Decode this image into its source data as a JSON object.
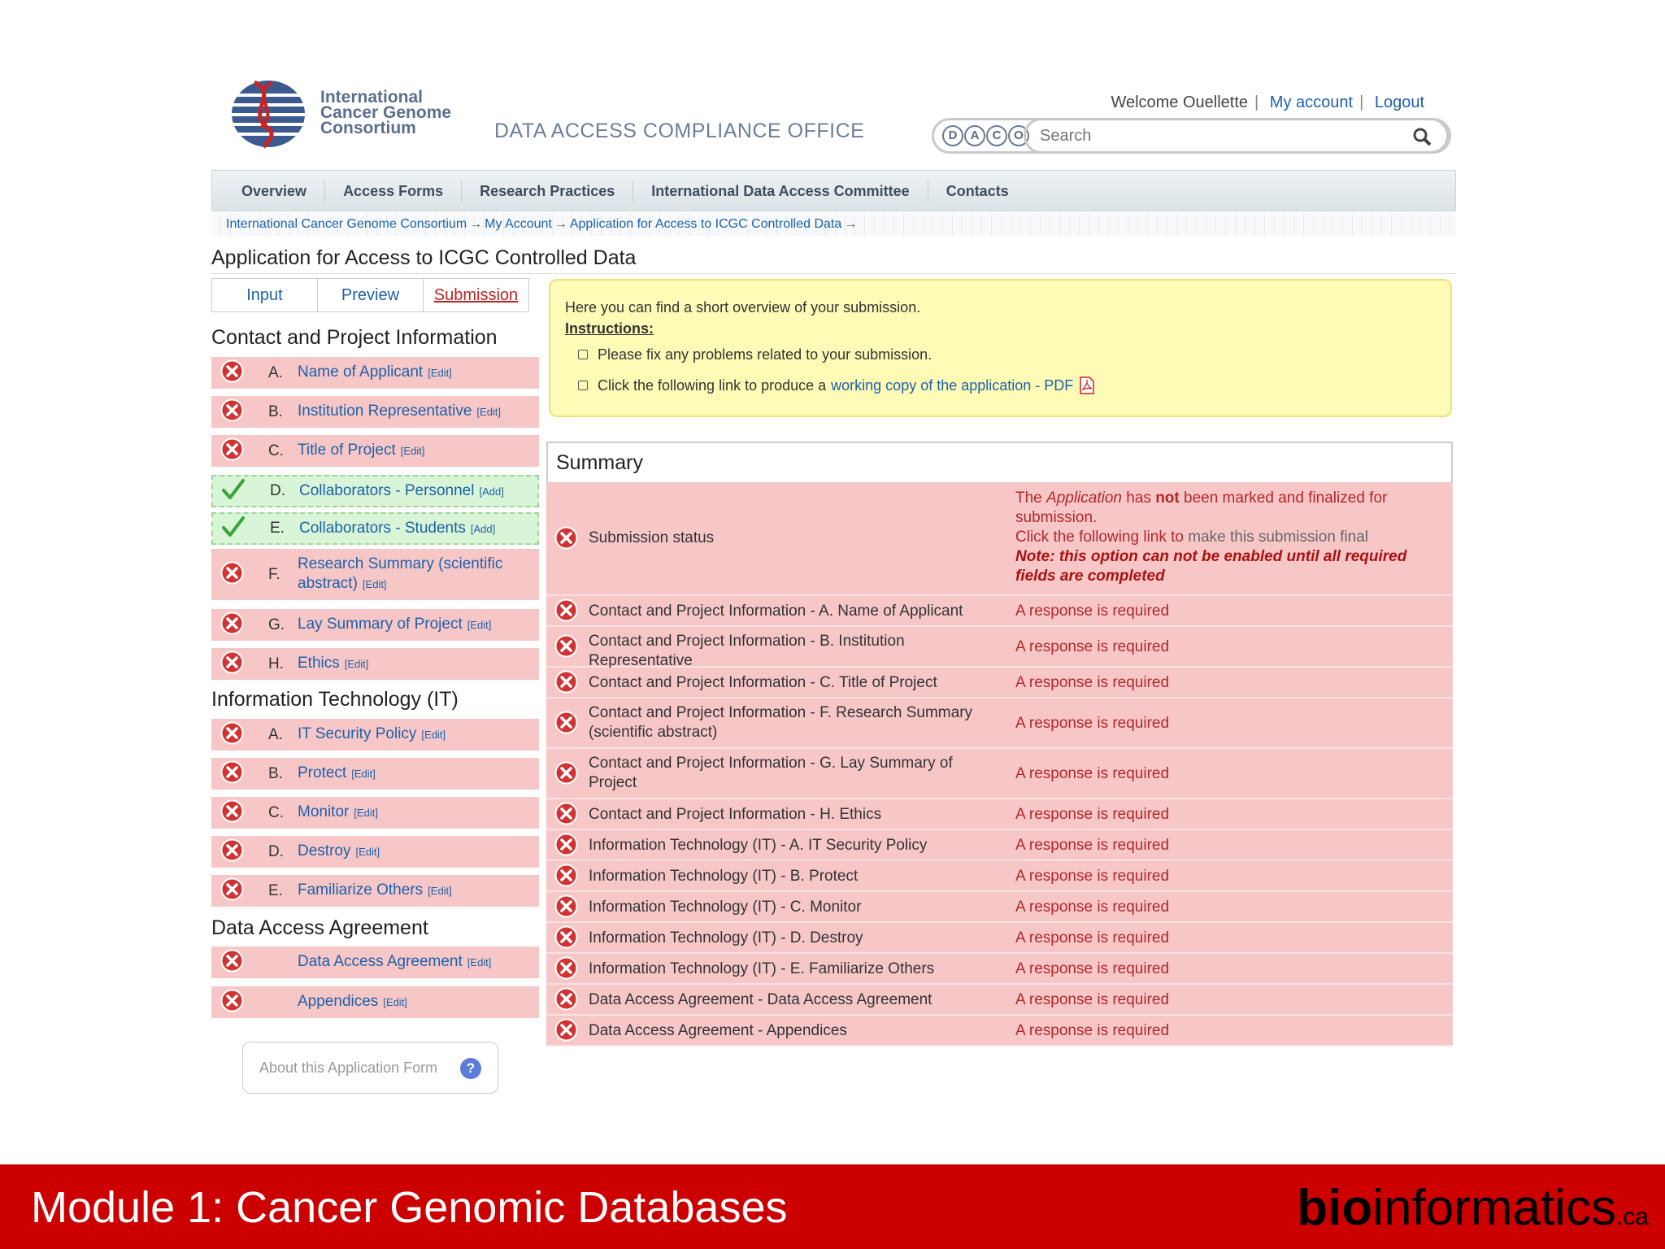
{
  "header": {
    "logo_text_1": "International",
    "logo_text_2": "Cancer Genome",
    "logo_text_3": "Consortium",
    "office": "DATA ACCESS COMPLIANCE OFFICE",
    "welcome": "Welcome Ouellette",
    "my_account": "My account",
    "logout": "Logout",
    "daco_letters": [
      "D",
      "A",
      "C",
      "O"
    ],
    "search_placeholder": "Search"
  },
  "nav": [
    "Overview",
    "Access Forms",
    "Research Practices",
    "International Data Access Committee",
    "Contacts"
  ],
  "breadcrumb": [
    "International Cancer Genome Consortium",
    "My Account",
    "Application for Access to ICGC Controlled Data"
  ],
  "page_title": "Application for Access to ICGC Controlled Data",
  "tabs": [
    "Input",
    "Preview",
    "Submission"
  ],
  "sections": {
    "contact": {
      "title": "Contact and Project Information",
      "items": [
        {
          "letter": "A.",
          "label": "Name of Applicant",
          "action": "[Edit]"
        },
        {
          "letter": "B.",
          "label": "Institution Representative",
          "action": "[Edit]"
        },
        {
          "letter": "C.",
          "label": "Title of Project",
          "action": "[Edit]"
        },
        {
          "letter": "D.",
          "label": "Collaborators - Personnel",
          "action": "[Add]"
        },
        {
          "letter": "E.",
          "label": "Collaborators - Students",
          "action": "[Add]"
        },
        {
          "letter": "F.",
          "label": "Research Summary (scientific abstract)",
          "action": "[Edit]"
        },
        {
          "letter": "G.",
          "label": "Lay Summary of Project",
          "action": "[Edit]"
        },
        {
          "letter": "H.",
          "label": "Ethics",
          "action": "[Edit]"
        }
      ]
    },
    "it": {
      "title": "Information Technology (IT)",
      "items": [
        {
          "letter": "A.",
          "label": "IT Security Policy",
          "action": "[Edit]"
        },
        {
          "letter": "B.",
          "label": "Protect",
          "action": "[Edit]"
        },
        {
          "letter": "C.",
          "label": "Monitor",
          "action": "[Edit]"
        },
        {
          "letter": "D.",
          "label": "Destroy",
          "action": "[Edit]"
        },
        {
          "letter": "E.",
          "label": "Familiarize Others",
          "action": "[Edit]"
        }
      ]
    },
    "daa": {
      "title": "Data Access Agreement",
      "items": [
        {
          "letter": "",
          "label": "Data Access Agreement",
          "action": "[Edit]"
        },
        {
          "letter": "",
          "label": "Appendices",
          "action": "[Edit]"
        }
      ]
    }
  },
  "about": "About this Application Form",
  "instructions": {
    "intro": "Here you can find a short overview of your submission.",
    "heading": "Instructions:",
    "bullet1": "Please fix any problems related to your submission.",
    "bullet2": "Click the following link to produce a",
    "link": "working copy of the application - PDF"
  },
  "summary": {
    "title": "Summary",
    "status_label": "Submission status",
    "status_p1a": "The",
    "status_p1b": "Application",
    "status_p1c": "has",
    "status_p1d": "not",
    "status_p1e": "been marked and finalized for submission.",
    "status_p2a": "Click the following link to",
    "status_p2b": "make this submission final",
    "status_note": "Note: this option can not be enabled until all required fields are completed",
    "rows": [
      {
        "field": "Contact and Project Information - A. Name of Applicant",
        "msg": "A response is required"
      },
      {
        "field": "Contact and Project Information - B. Institution Representative",
        "msg": "A response is required"
      },
      {
        "field": "Contact and Project Information - C. Title of Project",
        "msg": "A response is required"
      },
      {
        "field": "Contact and Project Information - F. Research Summary (scientific abstract)",
        "msg": "A response is required"
      },
      {
        "field": "Contact and Project Information - G. Lay Summary of Project",
        "msg": "A response is required"
      },
      {
        "field": "Contact and Project Information - H. Ethics",
        "msg": "A response is required"
      },
      {
        "field": "Information Technology (IT) - A. IT Security Policy",
        "msg": "A response is required"
      },
      {
        "field": "Information Technology (IT) - B. Protect",
        "msg": "A response is required"
      },
      {
        "field": "Information Technology (IT) - C. Monitor",
        "msg": "A response is required"
      },
      {
        "field": "Information Technology (IT) - D. Destroy",
        "msg": "A response is required"
      },
      {
        "field": "Information Technology (IT) - E. Familiarize Others",
        "msg": "A response is required"
      },
      {
        "field": "Data Access Agreement - Data Access Agreement",
        "msg": "A response is required"
      },
      {
        "field": "Data Access Agreement - Appendices",
        "msg": "A response is required"
      }
    ]
  },
  "footer": {
    "title": "Module 1: Cancer Genomic Databases",
    "brand_bold": "bio",
    "brand_rest": "informatics",
    "brand_suffix": ".ca"
  },
  "colors": {
    "error_bg": "#f7c7c8",
    "ok_bg": "#d9f5d8",
    "link": "#1d61a8",
    "footer": "#cc0000"
  }
}
